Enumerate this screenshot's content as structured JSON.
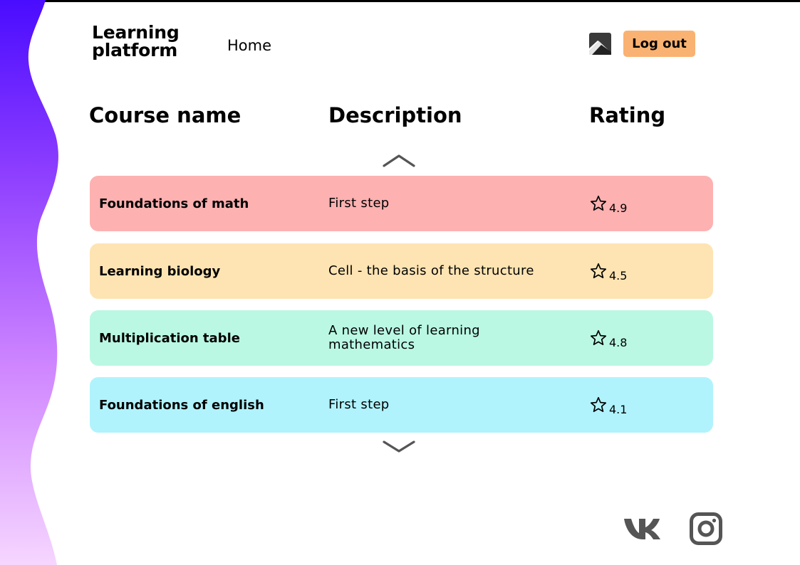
{
  "header": {
    "logo_line1": "Learning",
    "logo_line2": "platform",
    "nav_home": "Home",
    "logout_label": "Log out"
  },
  "table": {
    "columns": [
      "Course name",
      "Description",
      "Rating"
    ],
    "rows": [
      {
        "name": "Foundations of math",
        "description": "First step",
        "rating": "4.9",
        "color": "#fdb1b1"
      },
      {
        "name": "Learning biology",
        "description": "Cell - the basis of the structure",
        "rating": "4.5",
        "color": "#fee4b3"
      },
      {
        "name": "Multiplication table",
        "description": "A new level of learning mathematics",
        "rating": "4.8",
        "color": "#baf8e4"
      },
      {
        "name": "Foundations of english",
        "description": "First step",
        "rating": "4.1",
        "color": "#b0f3fd"
      }
    ]
  },
  "icons": {
    "avatar": "image-avatar-icon",
    "scroll_up": "chevron-up-icon",
    "scroll_down": "chevron-down-icon",
    "rating": "star-outline-icon",
    "social": [
      "vk-icon",
      "instagram-icon"
    ]
  },
  "colors": {
    "accent_button": "#f9b271",
    "wave_top": "#4a0cff",
    "wave_bottom": "#f6d6ff",
    "social_icon": "#555555"
  }
}
